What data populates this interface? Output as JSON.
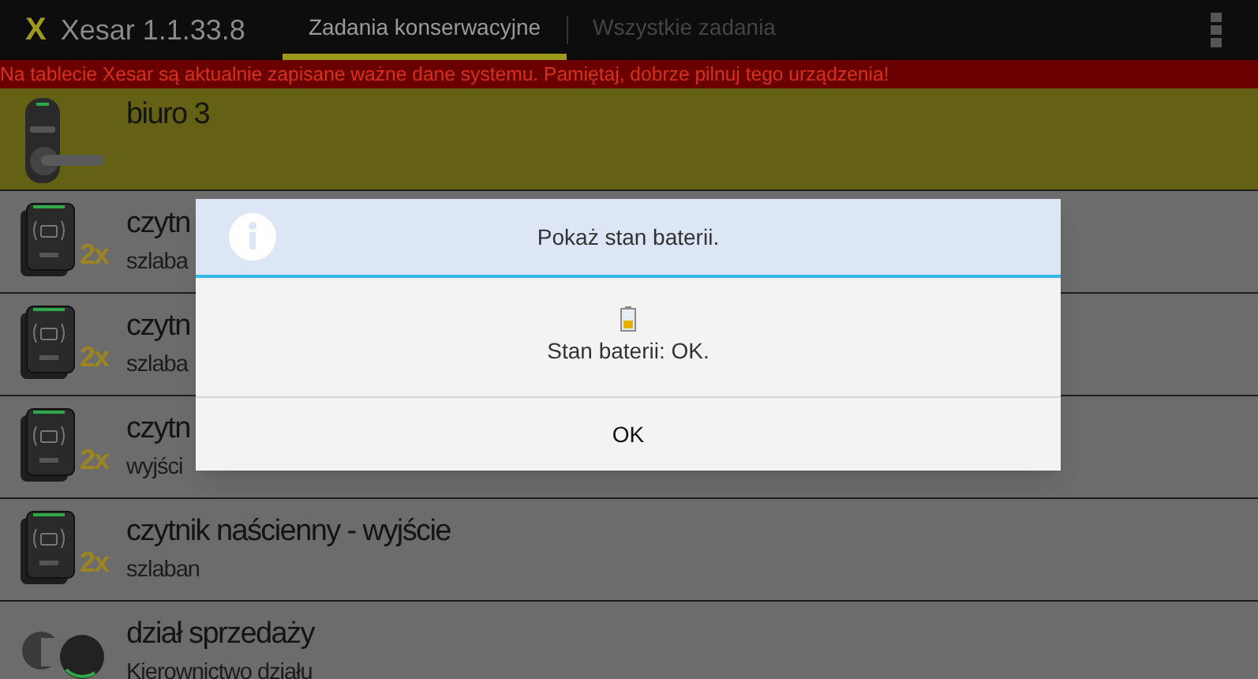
{
  "app_bar": {
    "logo": "X",
    "title": "Xesar 1.1.33.8"
  },
  "tabs": [
    {
      "label": "Zadania konserwacyjne",
      "selected": true
    },
    {
      "label": "Wszystkie zadania",
      "selected": false
    }
  ],
  "warning_banner": "Na tablecie Xesar są aktualnie zapisane ważne dane systemu. Pamiętaj, dobrze pilnuj tego urządzenia!",
  "items": [
    {
      "kind": "handle",
      "title": "biuro 3",
      "selected": true
    },
    {
      "kind": "reader",
      "badge": "2x",
      "title": "czytn",
      "subtitle": "szlaba",
      "selected": false
    },
    {
      "kind": "reader",
      "badge": "2x",
      "title": "czytn",
      "subtitle": "szlaba",
      "selected": false
    },
    {
      "kind": "reader",
      "badge": "2x",
      "title": "czytn",
      "subtitle": "wyjści",
      "selected": false
    },
    {
      "kind": "reader",
      "badge": "2x",
      "title": "czytnik naścienny - wyjście",
      "subtitle": "szlaban",
      "selected": false
    },
    {
      "kind": "cylinder",
      "title": "dział sprzedaży",
      "subtitle": "Kierownictwo działu",
      "selected": false
    }
  ],
  "dialog": {
    "title": "Pokaż stan baterii.",
    "message": "Stan baterii: OK.",
    "button": "OK"
  }
}
